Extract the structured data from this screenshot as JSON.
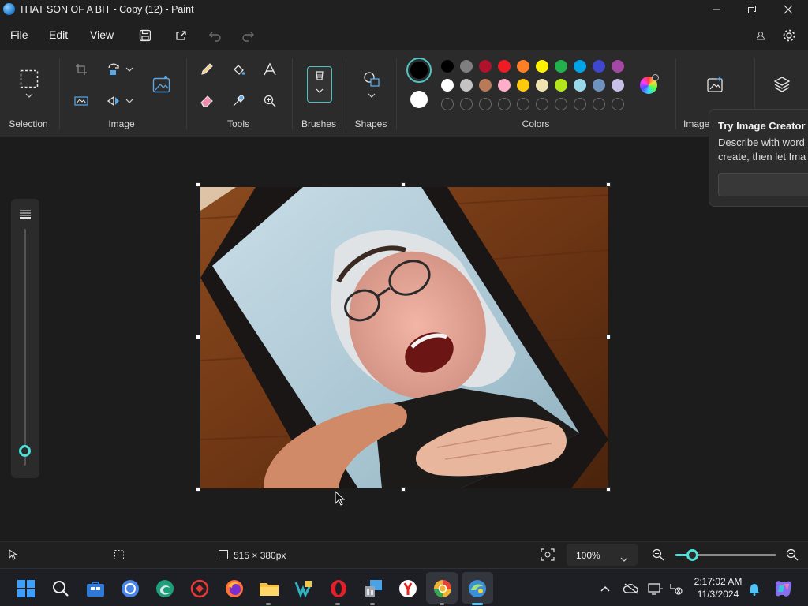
{
  "window": {
    "title": "THAT SON OF A BIT - Copy (12) - Paint",
    "controls": [
      "minimize",
      "restore",
      "close"
    ]
  },
  "menu": {
    "file": "File",
    "edit": "Edit",
    "view": "View"
  },
  "ribbon": {
    "groups": {
      "selection": "Selection",
      "image": "Image",
      "tools": "Tools",
      "brushes": "Brushes",
      "shapes": "Shapes",
      "colors": "Colors",
      "image_creator": "Image"
    },
    "colors": {
      "primary": "#000000",
      "secondary": "#ffffff",
      "palette_row1": [
        "#000000",
        "#7f7f7f",
        "#b0112b",
        "#ed1c24",
        "#ff7f27",
        "#fff200",
        "#22b14c",
        "#00a2e8",
        "#3f48cc",
        "#a349a4"
      ],
      "palette_row2": [
        "#ffffff",
        "#c3c3c3",
        "#b97a57",
        "#ffaec9",
        "#ffc90e",
        "#efe4b0",
        "#b5e61d",
        "#99d9ea",
        "#7092be",
        "#c8bfe7"
      ]
    }
  },
  "popup": {
    "title": "Try Image Creator",
    "line1": "Describe with word",
    "line2": "create, then let Ima"
  },
  "status": {
    "image_size": "515 × 380px",
    "zoom": "100%",
    "zoom_level": 0.12
  },
  "brush_size_level": 0.04,
  "clock": {
    "time": "2:17:02 AM",
    "date": "11/3/2024"
  },
  "taskbar": {
    "apps": [
      "start",
      "search",
      "taskview",
      "chrome",
      "edge-dev",
      "photoshop-express",
      "firefox",
      "file-explorer",
      "visual-studio",
      "opera",
      "control-panel",
      "yandex",
      "chrome-canary",
      "paint"
    ]
  }
}
